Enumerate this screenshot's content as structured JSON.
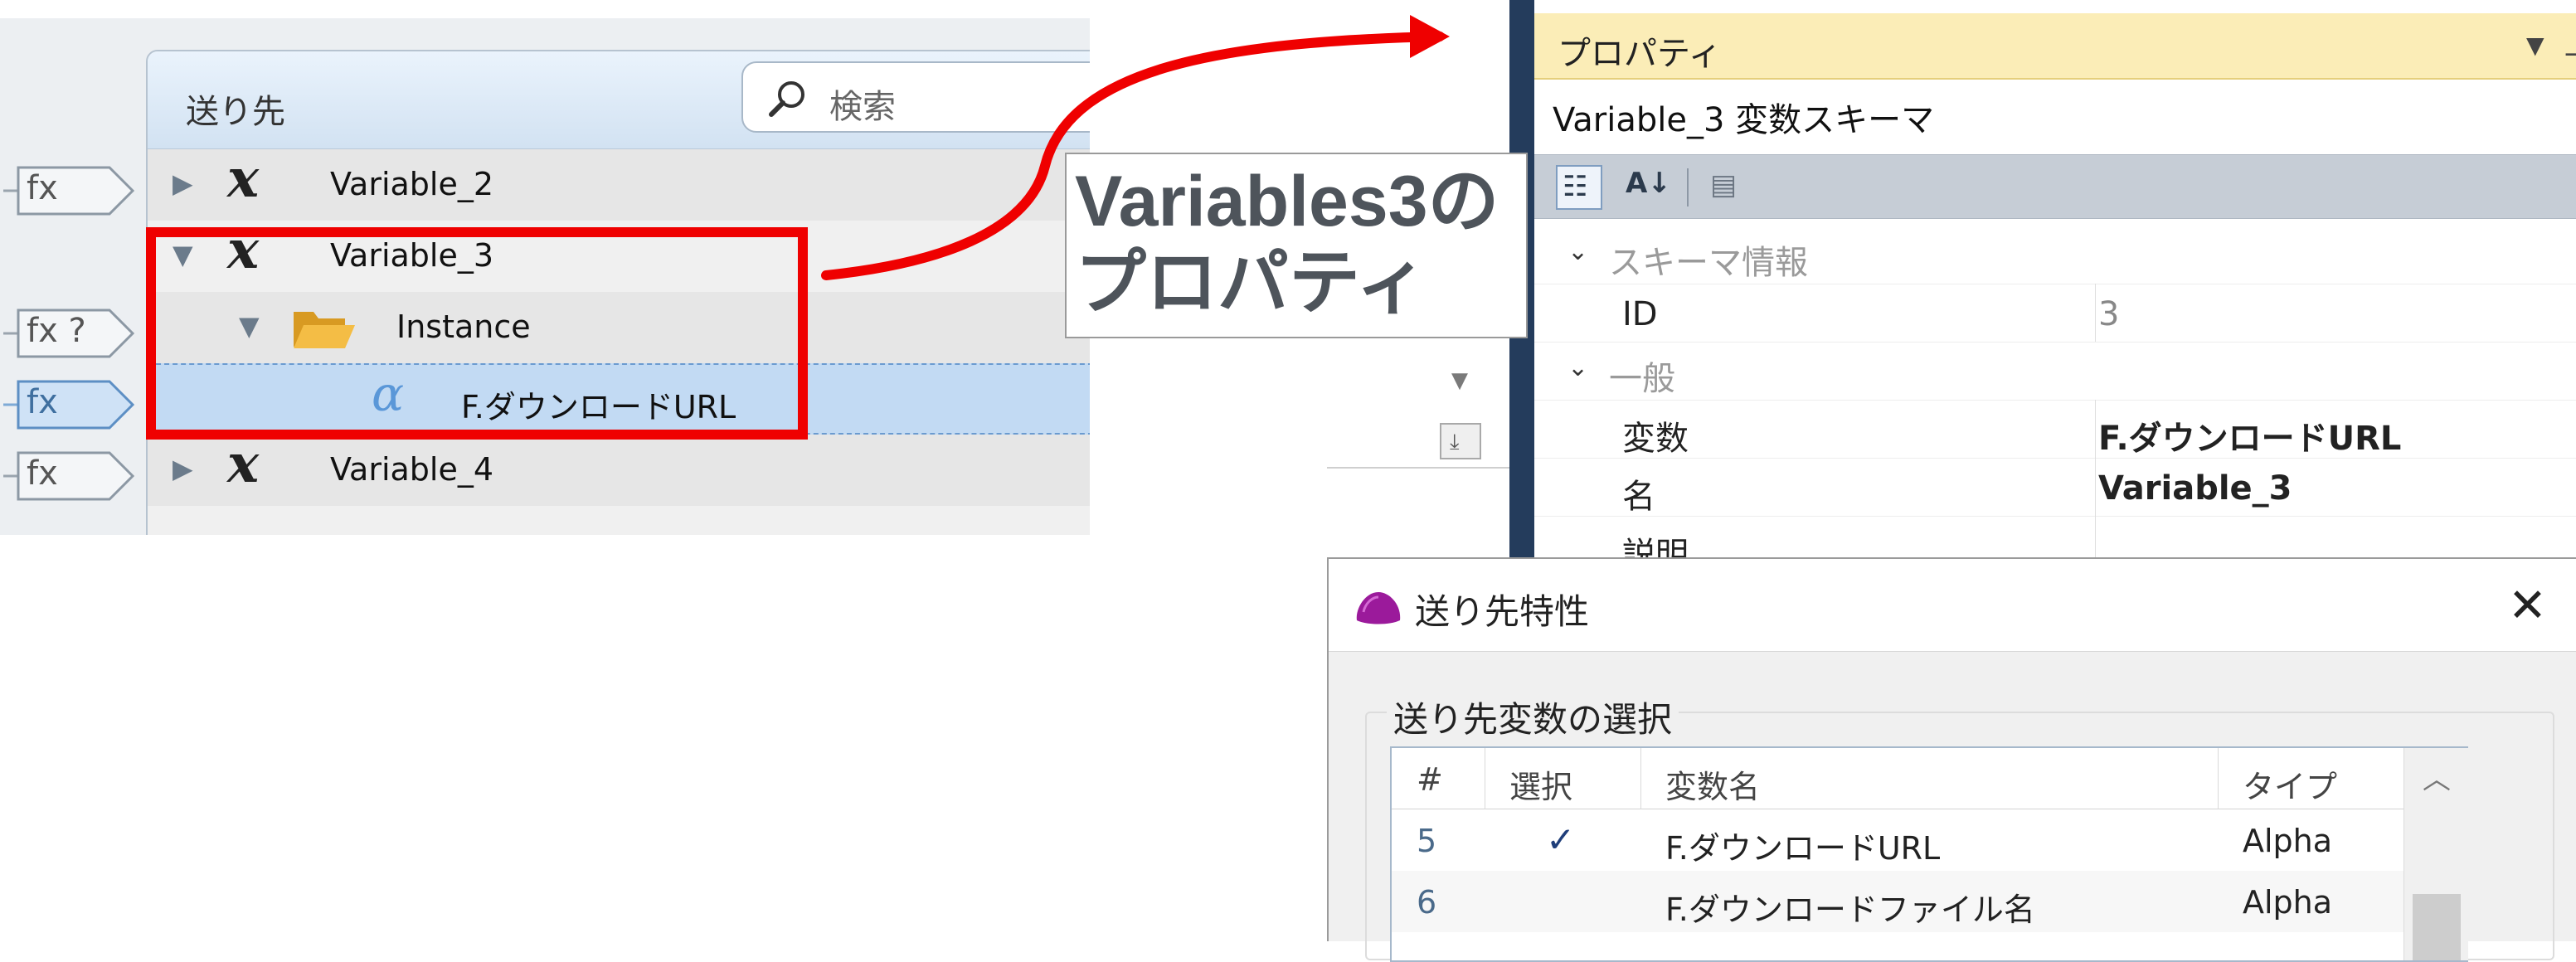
{
  "tree": {
    "header_label": "送り先",
    "search_placeholder": "検索",
    "fx_labels": [
      "fx",
      "fx ?",
      "fx",
      "fx"
    ],
    "rows": [
      {
        "label": "Variable_2",
        "icon": "variable-x-icon",
        "expanded": false
      },
      {
        "label": "Variable_3",
        "icon": "variable-x-icon",
        "expanded": true
      },
      {
        "label": "Instance",
        "icon": "folder-open-icon",
        "expanded": true
      },
      {
        "label": "F.ダウンロードURL",
        "icon": "alpha-icon",
        "selected": true
      },
      {
        "label": "Variable_4",
        "icon": "variable-x-icon",
        "expanded": false
      }
    ],
    "colors": {
      "selection": "#c2daf3",
      "highlight": "#ef0000",
      "folder": "#f0b030"
    }
  },
  "callout": {
    "line1": "Variables3の",
    "line2": "プロパティ"
  },
  "properties": {
    "title": "プロパティ",
    "object": "Variable_3  変数スキーマ",
    "categories": [
      {
        "label": "スキーマ情報",
        "rows": [
          {
            "name": "ID",
            "value": "3"
          }
        ]
      },
      {
        "label": "一般",
        "rows": [
          {
            "name": "変数",
            "value": "F.ダウンロードURL"
          },
          {
            "name": "名",
            "value": "Variable_3"
          },
          {
            "name": "説明",
            "value": ""
          }
        ]
      }
    ]
  },
  "dialog": {
    "title": "送り先特性",
    "group_label": "送り先変数の選択",
    "columns": [
      "#",
      "選択",
      "変数名",
      "タイプ"
    ],
    "rows": [
      {
        "num": "5",
        "selected": "✓",
        "name": "F.ダウンロードURL",
        "type": "Alpha"
      },
      {
        "num": "6",
        "selected": "",
        "name": "F.ダウンロードファイル名",
        "type": "Alpha"
      }
    ]
  }
}
